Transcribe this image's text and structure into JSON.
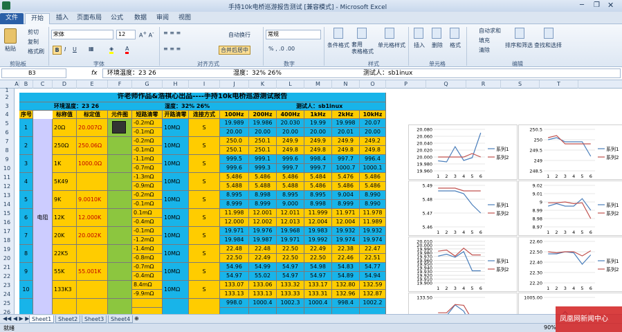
{
  "window": {
    "title": "手持10k电桥巡游报告测试 [兼容模式] - Microsoft Excel"
  },
  "tabs": [
    "文件",
    "开始",
    "插入",
    "页面布局",
    "公式",
    "数据",
    "审阅",
    "视图"
  ],
  "ribbon": {
    "paste": "粘贴",
    "cut": "剪切",
    "copy": "复制",
    "format_painter": "格式刷",
    "clipboard": "剪贴板",
    "font_name": "宋体",
    "font_size": "12",
    "font_group": "字体",
    "wrap": "自动换行",
    "merge": "合并后居中",
    "align_group": "对齐方式",
    "number_format": "常规",
    "number_group": "数字",
    "cond_format": "条件格式",
    "table_format": "套用\n表格格式",
    "cell_style": "单元格样式",
    "style_group": "样式",
    "insert": "插入",
    "delete": "删除",
    "format": "格式",
    "cells_group": "单元格",
    "autosum": "自动求和",
    "fill": "填充",
    "clear": "清除",
    "sort": "排序和筛选",
    "find": "查找和选择",
    "edit_group": "编辑"
  },
  "formula_bar": {
    "cell_ref": "B3",
    "fx": "fx",
    "content": "环境温度：23  26",
    "mid": "湿度：32% 26%",
    "right": "测试人：sb1inux"
  },
  "columns": [
    "A",
    "B",
    "C",
    "D",
    "E",
    "F",
    "G",
    "H",
    "I",
    "J",
    "K",
    "L",
    "M",
    "N",
    "O",
    "P",
    "Q",
    "R",
    "S",
    "T"
  ],
  "rows": [
    "1",
    "2",
    "3",
    "4",
    "5",
    "6",
    "7",
    "8",
    "9",
    "10",
    "11",
    "12",
    "13",
    "14",
    "15",
    "16",
    "17",
    "18",
    "19",
    "20",
    "21",
    "22",
    "23",
    "24",
    "25",
    "26"
  ],
  "report": {
    "title": "许老师作品&浩祺心出品----手持10k电桥巡游测试报告",
    "temp": "环境温度：23  26",
    "humidity": "湿度：32% 26%",
    "tester": "测试人：sb1inux",
    "headers": [
      "序号",
      "标称值",
      "标定值",
      "元件图",
      "短路清零",
      "开路清零",
      "连接方式",
      "100Hz",
      "200Hz",
      "400Hz",
      "1kHz",
      "2kHz",
      "10kHz"
    ],
    "category": "电阻",
    "items": [
      {
        "no": "1",
        "nominal": "20Ω",
        "cal": "20.007Ω",
        "short": [
          "-0.2mΩ",
          "-0.1mΩ"
        ],
        "open": "10MΩ",
        "conn": "S",
        "v1": [
          "19.989",
          "19.986",
          "20.030",
          "19.99",
          "19.998",
          "20.07"
        ],
        "v2": [
          "20.00",
          "20.00",
          "20.00",
          "20.00",
          "20.01",
          "20.00"
        ]
      },
      {
        "no": "2",
        "nominal": "250Ω",
        "cal": "250.06Ω",
        "short": [
          "-0.2mΩ",
          "-0.1mΩ"
        ],
        "open": "10MΩ",
        "conn": "S",
        "v1": [
          "250.0",
          "250.1",
          "249.9",
          "249.9",
          "249.9",
          "249.2"
        ],
        "v2": [
          "250.1",
          "250.1",
          "249.8",
          "249.8",
          "249.8",
          "249.8"
        ]
      },
      {
        "no": "3",
        "nominal": "1K",
        "cal": "1000.0Ω",
        "short": [
          "-1.1mΩ",
          "-0.7mΩ"
        ],
        "open": "10MΩ",
        "conn": "S",
        "v1": [
          "999.5",
          "999.1",
          "999.6",
          "998.4",
          "997.7",
          "996.4"
        ],
        "v2": [
          "999.6",
          "999.3",
          "999.7",
          "999.7",
          "1000.7",
          "1000.1"
        ]
      },
      {
        "no": "4",
        "nominal": "5K49",
        "cal": "",
        "short": [
          "-1.3mΩ",
          "-0.9mΩ"
        ],
        "open": "10MΩ",
        "conn": "S",
        "v1": [
          "5.486",
          "5.486",
          "5.486",
          "5.484",
          "5.476",
          "5.486"
        ],
        "v2": [
          "5.488",
          "5.488",
          "5.488",
          "5.486",
          "5.486",
          "5.486"
        ]
      },
      {
        "no": "5",
        "nominal": "9K",
        "cal": "9.0010K",
        "short": [
          "-0.2mΩ",
          "-0.1mΩ"
        ],
        "open": "10MΩ",
        "conn": "S",
        "v1": [
          "8.995",
          "8.998",
          "8.995",
          "8.995",
          "9.004",
          "8.990"
        ],
        "v2": [
          "8.999",
          "8.999",
          "9.000",
          "8.998",
          "8.999",
          "8.990"
        ]
      },
      {
        "no": "6",
        "nominal": "12K",
        "cal": "12.000K",
        "short": [
          "0.1mΩ",
          "-0.4mΩ"
        ],
        "open": "10MΩ",
        "conn": "S",
        "v1": [
          "11.998",
          "12.001",
          "12.011",
          "11.999",
          "11.971",
          "11.978"
        ],
        "v2": [
          "12.000",
          "12.002",
          "12.013",
          "12.004",
          "12.004",
          "11.989"
        ]
      },
      {
        "no": "7",
        "nominal": "20K",
        "cal": "20.002K",
        "short": [
          "-0.1mΩ",
          "-1.2mΩ"
        ],
        "open": "10MΩ",
        "conn": "S",
        "v1": [
          "19.971",
          "19.976",
          "19.968",
          "19.983",
          "19.932",
          "19.932"
        ],
        "v2": [
          "19.984",
          "19.987",
          "19.971",
          "19.992",
          "19.974",
          "19.974"
        ]
      },
      {
        "no": "8",
        "nominal": "22K5",
        "cal": "",
        "short": [
          "-1.4mΩ",
          "-0.8mΩ"
        ],
        "open": "10MΩ",
        "conn": "S",
        "v1": [
          "22.48",
          "22.48",
          "22.50",
          "22.49",
          "22.38",
          "22.47"
        ],
        "v2": [
          "22.50",
          "22.49",
          "22.50",
          "22.50",
          "22.46",
          "22.51"
        ]
      },
      {
        "no": "9",
        "nominal": "55K",
        "cal": "55.001K",
        "short": [
          "-0.7mΩ",
          "-0.4mΩ"
        ],
        "open": "10MΩ",
        "conn": "S",
        "v1": [
          "54.96",
          "54.99",
          "54.97",
          "54.98",
          "54.83",
          "54.77"
        ],
        "v2": [
          "54.97",
          "55.02",
          "54.97",
          "54.97",
          "54.89",
          "54.94"
        ]
      },
      {
        "no": "10",
        "nominal": "133K3",
        "cal": "",
        "short": [
          "8.4mΩ",
          "-9.9mΩ"
        ],
        "open": "10MΩ",
        "conn": "S",
        "v1": [
          "133.07",
          "133.06",
          "133.32",
          "133.17",
          "132.80",
          "132.59"
        ],
        "v2": [
          "133.13",
          "133.13",
          "133.33",
          "133.31",
          "132.96",
          "132.87"
        ]
      },
      {
        "no": "",
        "nominal": "",
        "cal": "",
        "short": [
          "",
          ""
        ],
        "open": "",
        "conn": "",
        "v1": [
          "998.0",
          "1000.4",
          "1002.3",
          "1000.4",
          "998.4",
          "1002.2"
        ],
        "v2": [
          "",
          "",
          "",
          "",
          "",
          ""
        ]
      }
    ]
  },
  "charts": [
    {
      "yticks": [
        "20.080",
        "20.060",
        "20.040",
        "20.020",
        "20.000",
        "19.980",
        "19.960"
      ],
      "ymin": 19.96,
      "ymax": 20.08,
      "s1": [
        19.989,
        19.986,
        20.03,
        19.99,
        19.998,
        20.07
      ],
      "s2": [
        20.0,
        20.0,
        20.0,
        20.0,
        20.01,
        20.0
      ]
    },
    {
      "yticks": [
        "250.5",
        "250",
        "249.5",
        "249",
        "248.5"
      ],
      "ymin": 248.5,
      "ymax": 250.5,
      "s1": [
        250.0,
        250.1,
        249.9,
        249.9,
        249.9,
        249.2
      ],
      "s2": [
        250.1,
        250.2,
        249.8,
        249.8,
        249.8,
        249.8
      ]
    },
    {
      "yticks": [
        "5.49",
        "5.48",
        "5.47",
        "5.46"
      ],
      "ymin": 5.46,
      "ymax": 5.49,
      "s1": [
        5.486,
        5.486,
        5.486,
        5.484,
        5.476,
        5.47
      ],
      "s2": [
        5.488,
        5.488,
        5.488,
        5.486,
        5.486,
        5.486
      ]
    },
    {
      "yticks": [
        "9.02",
        "9.01",
        "9",
        "8.99",
        "8.98",
        "8.97"
      ],
      "ymin": 8.97,
      "ymax": 9.02,
      "s1": [
        8.995,
        8.998,
        8.995,
        8.995,
        9.004,
        8.99
      ],
      "s2": [
        8.999,
        8.999,
        9.0,
        8.998,
        8.999,
        8.98
      ]
    },
    {
      "yticks": [
        "20.010",
        "20.000",
        "19.990",
        "19.980",
        "19.970",
        "19.960",
        "19.950",
        "19.940",
        "19.930",
        "19.920",
        "19.910",
        "19.900"
      ],
      "ymin": 19.9,
      "ymax": 20.01,
      "s1": [
        19.971,
        19.976,
        19.968,
        19.983,
        19.932,
        19.932
      ],
      "s2": [
        19.984,
        19.987,
        19.971,
        19.992,
        19.974,
        19.974
      ]
    },
    {
      "yticks": [
        "22.60",
        "22.50",
        "22.40",
        "22.30",
        "22.20"
      ],
      "ymin": 22.2,
      "ymax": 22.6,
      "s1": [
        22.48,
        22.48,
        22.5,
        22.49,
        22.38,
        22.47
      ],
      "s2": [
        22.5,
        22.49,
        22.5,
        22.5,
        22.46,
        22.51
      ]
    },
    {
      "yticks": [
        "133.50",
        "133.00",
        "132.50"
      ],
      "ymin": 132.5,
      "ymax": 133.5,
      "s1": [
        133.07,
        133.06,
        133.32,
        133.17,
        132.8,
        132.59
      ],
      "s2": [
        133.13,
        133.13,
        133.33,
        133.31,
        132.96,
        132.87
      ]
    },
    {
      "yticks": [
        "1005.00",
        "1000.00"
      ],
      "ymin": 997,
      "ymax": 1005,
      "s1": [
        998.0,
        1000.4,
        1002.3,
        1000.4,
        998.4,
        1002.2
      ],
      "s2": [
        999.6,
        999.3,
        999.7,
        999.7,
        1000.7,
        1000.1
      ]
    }
  ],
  "legend": [
    "系列1",
    "系列2"
  ],
  "xcats": [
    "1",
    "2",
    "3",
    "4",
    "5",
    "6"
  ],
  "sheets": [
    "Sheet1",
    "Sheet2",
    "Sheet3",
    "Sheet4"
  ],
  "status": {
    "ready": "就绪",
    "zoom": "90%",
    "watermark": "凤凰网新闻中心"
  },
  "colors": {
    "blue": "#18b4e9",
    "yellow": "#ffcc00",
    "green": "#8cc63f",
    "s1": "#4a7ebb",
    "s2": "#c0504d"
  }
}
